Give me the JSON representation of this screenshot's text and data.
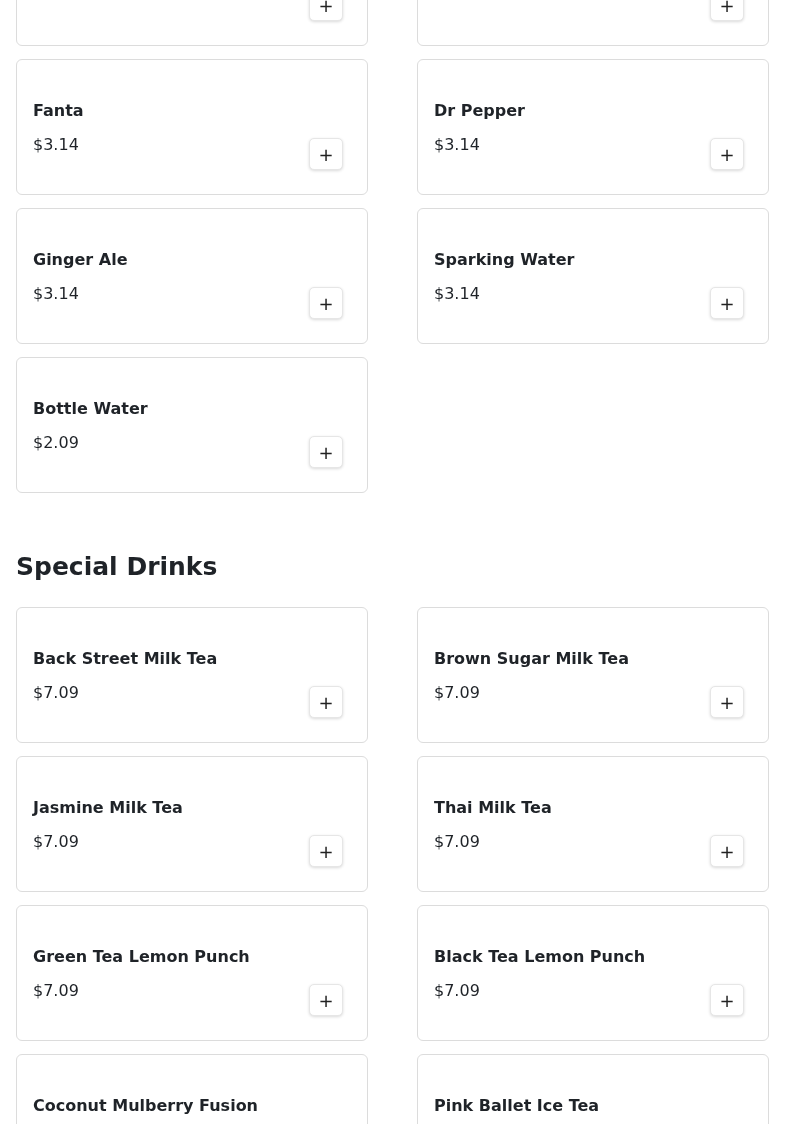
{
  "sections": [
    {
      "items": [
        {
          "button": "+"
        },
        {
          "button": "+"
        },
        {
          "name": "Fanta",
          "price": "$3.14",
          "button": "+"
        },
        {
          "name": "Dr Pepper",
          "price": "$3.14",
          "button": "+"
        },
        {
          "name": "Ginger Ale",
          "price": "$3.14",
          "button": "+"
        },
        {
          "name": "Sparking Water",
          "price": "$3.14",
          "button": "+"
        },
        {
          "name": "Bottle Water",
          "price": "$2.09",
          "button": "+"
        }
      ]
    },
    {
      "title": "Special Drinks",
      "items": [
        {
          "name": "Back Street Milk Tea",
          "price": "$7.09",
          "button": "+"
        },
        {
          "name": "Brown Sugar Milk Tea",
          "price": "$7.09",
          "button": "+"
        },
        {
          "name": "Jasmine Milk Tea",
          "price": "$7.09",
          "button": "+"
        },
        {
          "name": "Thai Milk Tea",
          "price": "$7.09",
          "button": "+"
        },
        {
          "name": "Green Tea Lemon Punch",
          "price": "$7.09",
          "button": "+"
        },
        {
          "name": "Black Tea Lemon Punch",
          "price": "$7.09",
          "button": "+"
        },
        {
          "name": "Coconut Mulberry Fusion"
        },
        {
          "name": "Pink Ballet Ice Tea"
        }
      ]
    }
  ]
}
